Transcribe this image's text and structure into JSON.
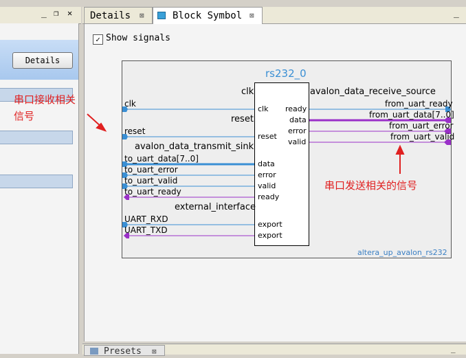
{
  "left_panel": {
    "details_button": "Details"
  },
  "tabs": [
    {
      "label": "Details",
      "close": "⊠"
    },
    {
      "label": "Block Symbol",
      "close": "⊠"
    }
  ],
  "window_controls": {
    "minimize": "_",
    "maximize": "❐",
    "close": "✕"
  },
  "show_signals": {
    "label": "Show signals",
    "checked": true
  },
  "symbol": {
    "instance_name": "rs232_0",
    "component": "altera_up_avalon_rs232",
    "interfaces": {
      "clk": "clk",
      "reset": "reset",
      "avalon_data_transmit_sink": "avalon_data_transmit_sink",
      "external_interface": "external_interface",
      "avalon_data_receive_source": "avalon_data_receive_source"
    },
    "left_pins": [
      "clk",
      "reset",
      "data",
      "error",
      "valid",
      "ready",
      "export",
      "export"
    ],
    "right_pins": [
      "ready",
      "data",
      "error",
      "valid"
    ],
    "left_signals": [
      "clk",
      "reset",
      "to_uart_data[7..0]",
      "to_uart_error",
      "to_uart_valid",
      "to_uart_ready",
      "UART_RXD",
      "UART_TXD"
    ],
    "right_signals": [
      "from_uart_ready",
      "from_uart_data[7..0]",
      "from_uart_error",
      "from_uart_valid"
    ]
  },
  "annotations": {
    "receive_line1": "串口接收相关",
    "receive_line2": "信号",
    "send": "串口发送相关的信号"
  },
  "bottom_tab": {
    "label": "Presets",
    "close": "⊠"
  },
  "colors": {
    "blue_wire": "#3a8fd4",
    "purple_wire": "#9a30c8",
    "annotation_red": "#e02020"
  }
}
